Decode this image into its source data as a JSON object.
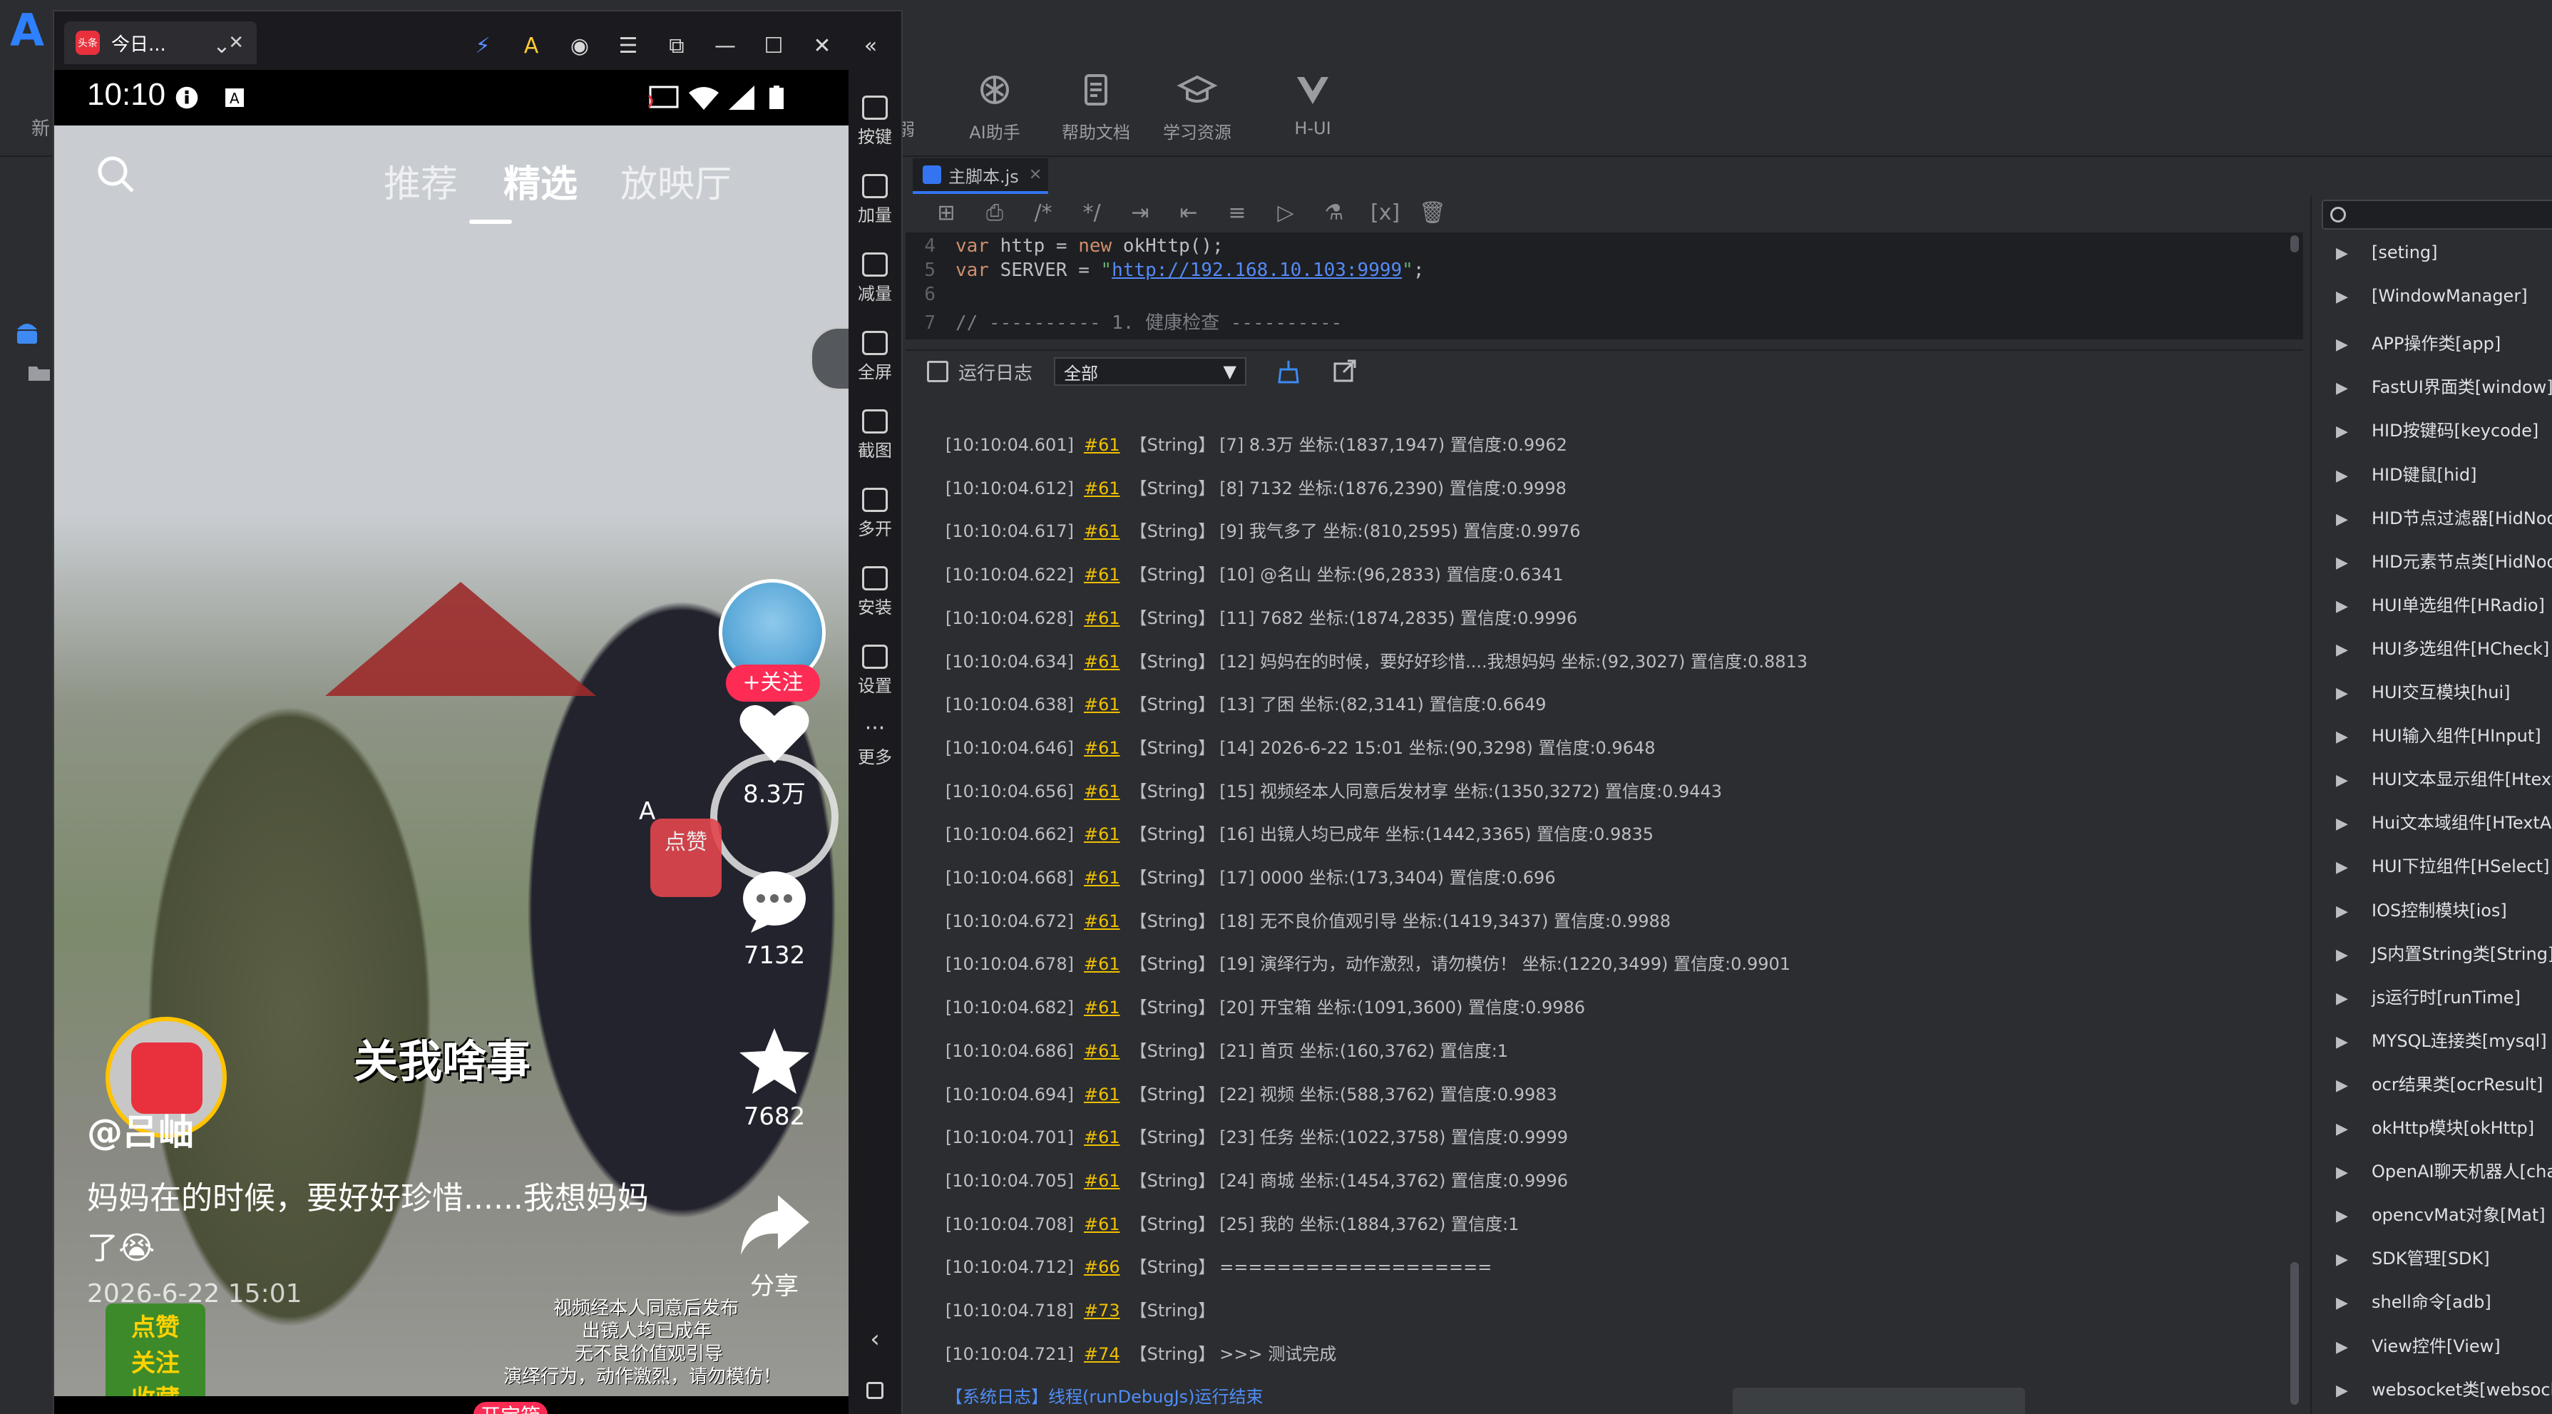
{
  "ide": {
    "logo": "A",
    "new_label": "新",
    "toolbar_buttons": [
      {
        "label": "AI助手",
        "icon": "openai-icon"
      },
      {
        "label": "帮助文档",
        "icon": "document-icon"
      },
      {
        "label": "学习资源",
        "icon": "graduation-cap-icon"
      },
      {
        "label": "H-UI",
        "icon": "vue-icon"
      }
    ],
    "partial_label": "弱",
    "file_tab": "主脚本.js",
    "code_lines": [
      {
        "num": "4",
        "kw1": "var",
        "text1": " http = ",
        "kw2": "new",
        "text2": " okHttp();"
      },
      {
        "num": "5",
        "kw1": "var",
        "text1": " SERVER = ",
        "url": "http://192.168.10.103:9999",
        "text2": ";"
      },
      {
        "num": "6"
      },
      {
        "num": "7",
        "comment": "// ---------- 1. 健康检查 ----------"
      }
    ],
    "log_header": {
      "title": "运行日志",
      "filter_value": "全部"
    },
    "log_lines": [
      {
        "time": "[10:10:04.601]",
        "ref": "#61",
        "type": "【String】",
        "msg": "[7] 8.3万 坐标:(1837,1947) 置信度:0.9962"
      },
      {
        "time": "[10:10:04.612]",
        "ref": "#61",
        "type": "【String】",
        "msg": "[8] 7132 坐标:(1876,2390) 置信度:0.9998"
      },
      {
        "time": "[10:10:04.617]",
        "ref": "#61",
        "type": "【String】",
        "msg": "[9] 我气多了 坐标:(810,2595) 置信度:0.9976"
      },
      {
        "time": "[10:10:04.622]",
        "ref": "#61",
        "type": "【String】",
        "msg": "[10] @名山 坐标:(96,2833) 置信度:0.6341"
      },
      {
        "time": "[10:10:04.628]",
        "ref": "#61",
        "type": "【String】",
        "msg": "[11] 7682 坐标:(1874,2835) 置信度:0.9996"
      },
      {
        "time": "[10:10:04.634]",
        "ref": "#61",
        "type": "【String】",
        "msg": "[12] 妈妈在的时候，要好好珍惜....我想妈妈 坐标:(92,3027) 置信度:0.8813"
      },
      {
        "time": "[10:10:04.638]",
        "ref": "#61",
        "type": "【String】",
        "msg": "[13] 了困 坐标:(82,3141) 置信度:0.6649"
      },
      {
        "time": "[10:10:04.646]",
        "ref": "#61",
        "type": "【String】",
        "msg": "[14] 2026-6-22 15:01 坐标:(90,3298) 置信度:0.9648"
      },
      {
        "time": "[10:10:04.656]",
        "ref": "#61",
        "type": "【String】",
        "msg": "[15] 视频经本人同意后发材享 坐标:(1350,3272) 置信度:0.9443"
      },
      {
        "time": "[10:10:04.662]",
        "ref": "#61",
        "type": "【String】",
        "msg": "[16] 出镜人均已成年 坐标:(1442,3365) 置信度:0.9835"
      },
      {
        "time": "[10:10:04.668]",
        "ref": "#61",
        "type": "【String】",
        "msg": "[17] 0000 坐标:(173,3404) 置信度:0.696"
      },
      {
        "time": "[10:10:04.672]",
        "ref": "#61",
        "type": "【String】",
        "msg": "[18] 无不良价值观引导 坐标:(1419,3437) 置信度:0.9988"
      },
      {
        "time": "[10:10:04.678]",
        "ref": "#61",
        "type": "【String】",
        "msg": "[19] 演绎行为，动作激烈，请勿模仿！ 坐标:(1220,3499) 置信度:0.9901"
      },
      {
        "time": "[10:10:04.682]",
        "ref": "#61",
        "type": "【String】",
        "msg": "[20] 开宝箱 坐标:(1091,3600) 置信度:0.9986"
      },
      {
        "time": "[10:10:04.686]",
        "ref": "#61",
        "type": "【String】",
        "msg": "[21] 首页 坐标:(160,3762) 置信度:1"
      },
      {
        "time": "[10:10:04.694]",
        "ref": "#61",
        "type": "【String】",
        "msg": "[22] 视频 坐标:(588,3762) 置信度:0.9983"
      },
      {
        "time": "[10:10:04.701]",
        "ref": "#61",
        "type": "【String】",
        "msg": "[23] 任务 坐标:(1022,3758) 置信度:0.9999"
      },
      {
        "time": "[10:10:04.705]",
        "ref": "#61",
        "type": "【String】",
        "msg": "[24] 商城 坐标:(1454,3762) 置信度:0.9996"
      },
      {
        "time": "[10:10:04.708]",
        "ref": "#61",
        "type": "【String】",
        "msg": "[25] 我的 坐标:(1884,3762) 置信度:1"
      },
      {
        "time": "[10:10:04.712]",
        "ref": "#66",
        "type": "【String】",
        "msg": "==================="
      },
      {
        "time": "[10:10:04.718]",
        "ref": "#73",
        "type": "【String】",
        "msg": ""
      },
      {
        "time": "[10:10:04.721]",
        "ref": "#74",
        "type": "【String】",
        "msg": ">>> 测试完成"
      }
    ],
    "system_log": "【系统日志】线程(runDebugJs)运行结束",
    "modules": [
      "[seting]",
      "[WindowManager]",
      "APP操作类[app]",
      "FastUI界面类[window]",
      "HID按键码[keycode]",
      "HID键鼠[hid]",
      "HID节点过滤器[HidNod",
      "HID元素节点类[HidNod",
      "HUI单选组件[HRadio]",
      "HUI多选组件[HCheck]",
      "HUI交互模块[hui]",
      "HUI输入组件[HInput]",
      "HUI文本显示组件[Htext",
      "Hui文本域组件[HTextAr",
      "HUI下拉组件[HSelect]",
      "IOS控制模块[ios]",
      "JS内置String类[String]",
      "js运行时[runTime]",
      "MYSQL连接类[mysql]",
      "ocr结果类[ocrResult]",
      "okHttp模块[okHttp]",
      "OpenAI聊天机器人[chat",
      "opencvMat对象[Mat]",
      "SDK管理[SDK]",
      "shell命令[adb]",
      "View控件[View]",
      "websocket类[websocke"
    ]
  },
  "emulator": {
    "tab_title": "今日...",
    "app_icon_text": "头条",
    "tools": [
      {
        "label": "按键",
        "icon": "keyboard-icon"
      },
      {
        "label": "加量",
        "icon": "volume-up-icon"
      },
      {
        "label": "减量",
        "icon": "volume-down-icon"
      },
      {
        "label": "全屏",
        "icon": "fullscreen-icon"
      },
      {
        "label": "截图",
        "icon": "scissors-icon"
      },
      {
        "label": "多开",
        "icon": "multi-instance-icon"
      },
      {
        "label": "安装",
        "icon": "apk-install-icon"
      },
      {
        "label": "设置",
        "icon": "settings-icon"
      },
      {
        "label": "更多",
        "icon": "more-icon"
      }
    ],
    "phone": {
      "clock": "10:10",
      "nav_tabs": [
        "推荐",
        "精选",
        "放映厅"
      ],
      "active_tab": 1,
      "follow": "+关注",
      "likes": "8.3万",
      "comments": "7132",
      "favorites": "7682",
      "share": "分享",
      "overlay_text": "A",
      "overlay_chip": "点赞",
      "subtitle": "关我啥事",
      "author": "@吕岫",
      "caption": "妈妈在的时候，要好好珍惜......我想妈妈了😭",
      "datetime": "2026-6-22 15:01",
      "badges": [
        "点赞",
        "关注",
        "收藏"
      ],
      "disclaimers": [
        "视频经本人同意后发布",
        "出镜人均已成年",
        "无不良价值观引导",
        "演绎行为，动作激烈，请勿模仿！"
      ],
      "open_chest": "开宝箱",
      "colors": {
        "accent": "#fe2c55",
        "packet_ring": "#ffc300"
      }
    }
  }
}
